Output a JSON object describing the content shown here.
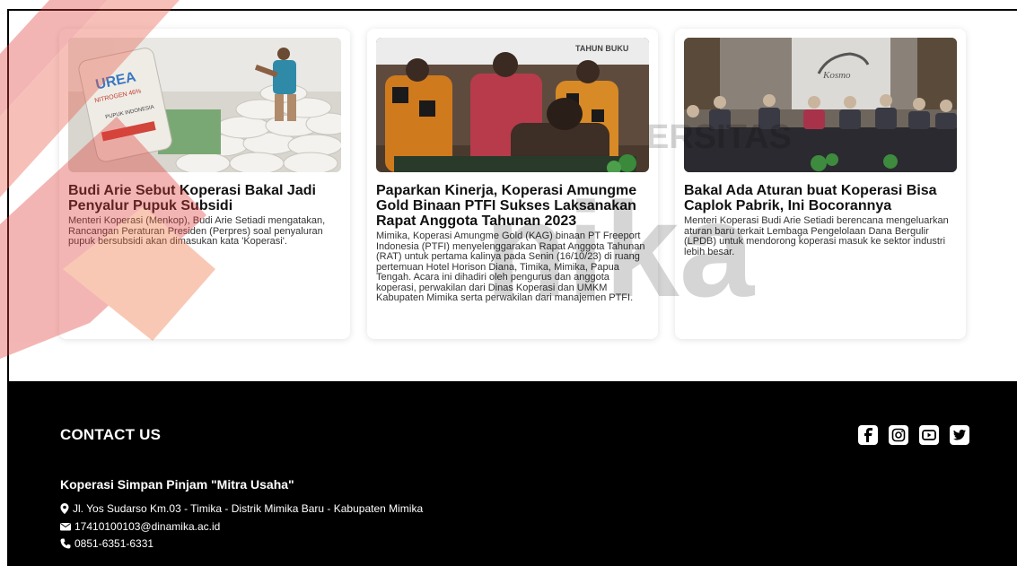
{
  "articles": [
    {
      "title": "Budi Arie Sebut Koperasi Bakal Jadi Penyalur Pupuk Subsidi",
      "summary": "Menteri Koperasi (Menkop), Budi Arie Setiadi mengatakan, Rancangan Peraturan Presiden (Perpres) soal penyaluran pupuk bersubsidi akan dimasukan kata 'Koperasi'.",
      "image_text": [
        "UREA",
        "NITROGEN 46%",
        "PUPUK INDONESIA"
      ]
    },
    {
      "title": "Paparkan Kinerja, Koperasi Amungme Gold Binaan PTFI Sukses Laksanakan Rapat Anggota Tahunan 2023",
      "summary": "Mimika, Koperasi Amungme Gold (KAG) binaan PT Freeport Indonesia (PTFI) menyelenggarakan Rapat Anggota Tahunan (RAT) untuk pertama kalinya pada Senin (16/10/23) di ruang pertemuan Hotel Horison Diana, Timika, Mimika, Papua Tengah. Acara ini dihadiri oleh pengurus dan anggota koperasi, perwakilan dari Dinas Koperasi dan UMKM Kabupaten Mimika serta perwakilan dari manajemen PTFI.",
      "image_text": [
        "TAHUN BUKU"
      ]
    },
    {
      "title": "Bakal Ada Aturan buat Koperasi Bisa Caplok Pabrik, Ini Bocorannya",
      "summary": "Menteri Koperasi Budi Arie Setiadi berencana mengeluarkan aturan baru terkait Lembaga Pengelolaan Dana Bergulir (LPDB) untuk mendorong koperasi masuk ke sektor industri lebih besar.",
      "image_text": [
        "Kosmo"
      ]
    }
  ],
  "watermark": {
    "letters": "nika",
    "small_text": "ERSITAS"
  },
  "footer": {
    "contact_title": "CONTACT US",
    "org_name": "Koperasi Simpan Pinjam \"Mitra Usaha\"",
    "address": "Jl. Yos Sudarso Km.03 - Timika - Distrik Mimika Baru - Kabupaten Mimika",
    "email": "17410100103@dinamika.ac.id",
    "phone": "0851-6351-6331",
    "socials": [
      "facebook-icon",
      "instagram-icon",
      "youtube-icon",
      "twitter-icon"
    ]
  },
  "colors": {
    "footer_bg": "#000000",
    "watermark_red": "#e0403a",
    "watermark_gray": "#d9d9d9"
  }
}
